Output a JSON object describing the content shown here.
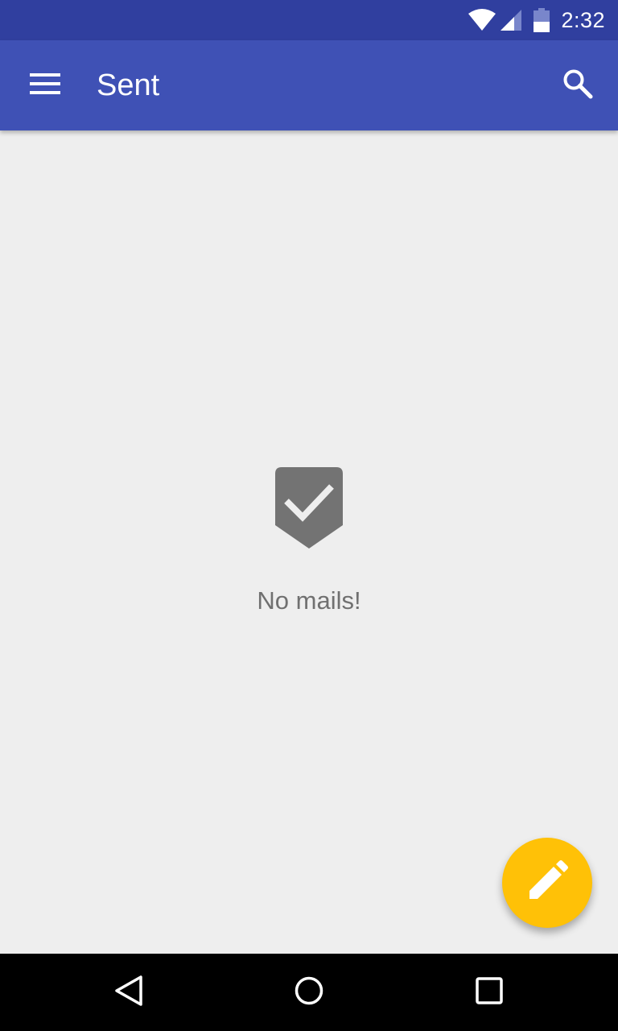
{
  "status_bar": {
    "time": "2:32",
    "icons": [
      "wifi-icon",
      "cell-signal-icon",
      "battery-icon"
    ]
  },
  "app_bar": {
    "title": "Sent",
    "menu_icon": "hamburger-menu-icon",
    "search_icon": "search-icon",
    "color": "#3f51b5"
  },
  "empty_state": {
    "icon": "check-badge-icon",
    "message": "No mails!"
  },
  "fab": {
    "icon": "pencil-icon",
    "color": "#ffc107"
  },
  "nav_bar": {
    "buttons": [
      "back-icon",
      "home-icon",
      "recents-icon"
    ]
  }
}
